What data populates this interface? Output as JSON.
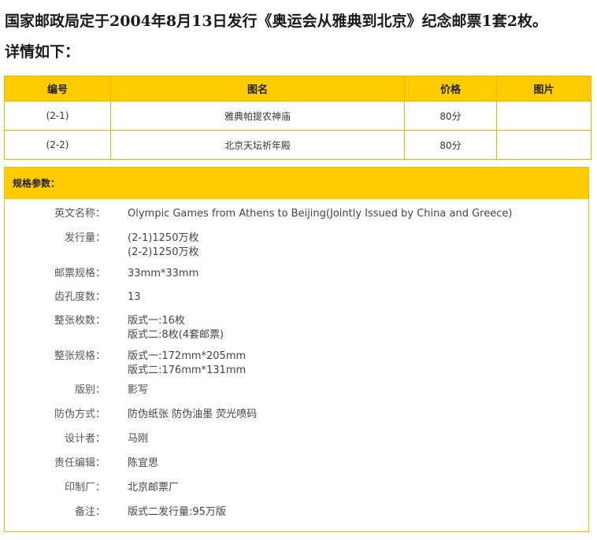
{
  "headline": {
    "line1": "国家邮政局定于2004年8月13日发行《奥运会从雅典到北京》纪念邮票1套2枚。",
    "line2": "详情如下："
  },
  "stamp_table": {
    "headers": [
      "编号",
      "图名",
      "价格",
      "图片"
    ],
    "rows": [
      {
        "number": "(2-1)",
        "name": "雅典帕提农神庙",
        "price": "80分",
        "image": ""
      },
      {
        "number": "(2-2)",
        "name": "北京天坛祈年殿",
        "price": "80分",
        "image": ""
      }
    ]
  },
  "specs": {
    "title": "规格参数：",
    "items": [
      {
        "label": "英文名称：",
        "values": [
          "Olympic Games from Athens to Beijing(Jointly Issued by China and Greece)"
        ]
      },
      {
        "label": "发行量：",
        "values": [
          "(2-1)1250万枚",
          "(2-2)1250万枚"
        ]
      },
      {
        "label": "邮票规格：",
        "values": [
          "33mm*33mm"
        ]
      },
      {
        "label": "齿孔度数：",
        "values": [
          "13"
        ]
      },
      {
        "label": "整张枚数：",
        "values": [
          "版式一:16枚",
          "版式二:8枚(4套邮票)"
        ]
      },
      {
        "label": "整张规格：",
        "values": [
          "版式一:172mm*205mm",
          "版式二:176mm*131mm"
        ]
      },
      {
        "label": "版别：",
        "values": [
          "影写"
        ]
      },
      {
        "label": "防伪方式：",
        "values": [
          "防伪纸张 防伪油墨 荧光喷码"
        ]
      },
      {
        "label": "设计者：",
        "values": [
          "马刚"
        ]
      },
      {
        "label": "责任编辑：",
        "values": [
          "陈宜思"
        ]
      },
      {
        "label": "印制厂：",
        "values": [
          "北京邮票厂"
        ]
      },
      {
        "label": "备注：",
        "values": [
          "版式二发行量:95万版"
        ]
      }
    ]
  }
}
